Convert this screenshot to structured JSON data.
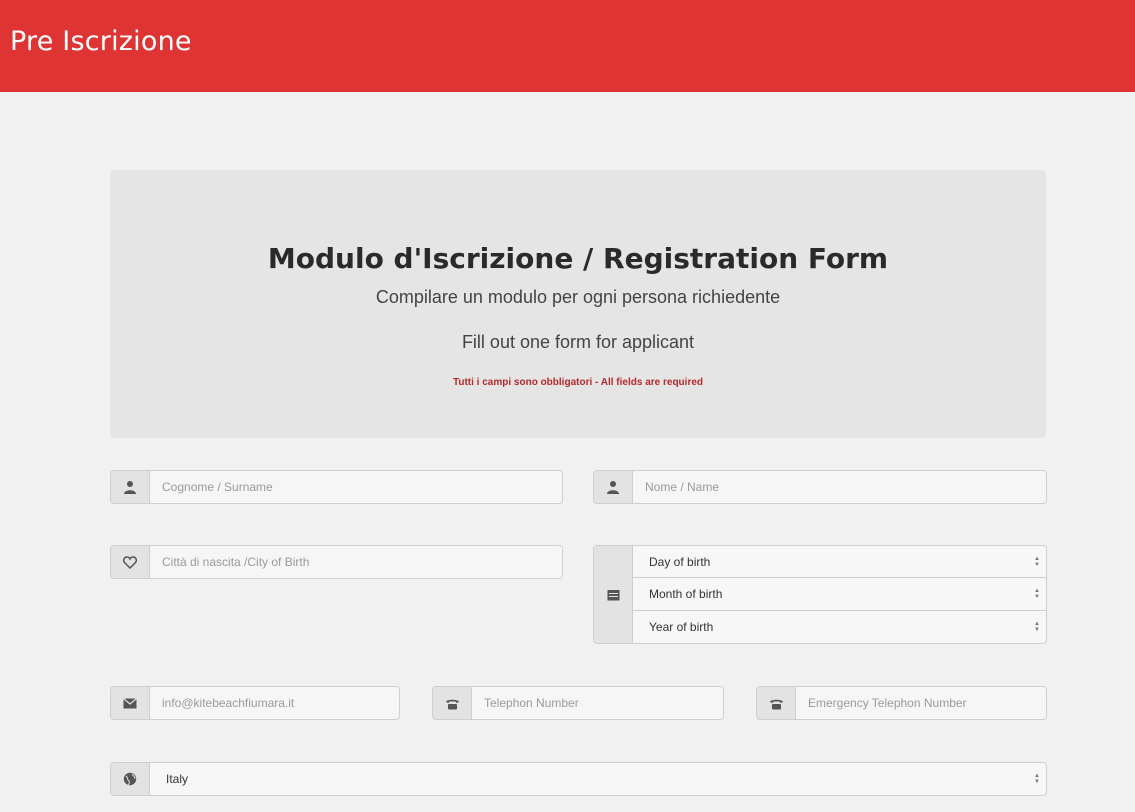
{
  "header": {
    "title": "Pre Iscrizione"
  },
  "jumbotron": {
    "title": "Modulo d'Iscrizione / Registration Form",
    "subtitle_it": "Compilare un modulo per ogni persona richiedente",
    "subtitle_en": "Fill out one form for applicant",
    "required_note": "Tutti i campi sono obbligatori - All fields are required"
  },
  "form": {
    "surname": {
      "placeholder": "Cognome / Surname",
      "icon": "user-icon"
    },
    "name": {
      "placeholder": "Nome / Name",
      "icon": "user-icon"
    },
    "birth_city": {
      "placeholder": "Città di nascita /City of Birth",
      "icon": "heart-icon"
    },
    "dob": {
      "icon": "calendar-icon",
      "day": "Day of birth",
      "month": "Month of birth",
      "year": "Year of birth"
    },
    "email": {
      "placeholder": "info@kitebeachfiumara.it",
      "icon": "envelope-icon"
    },
    "telephone": {
      "placeholder": "Telephon Number",
      "icon": "phone-icon"
    },
    "emergency_telephone": {
      "placeholder": "Emergency Telephon Number",
      "icon": "phone-icon"
    },
    "country": {
      "value": "Italy",
      "icon": "globe-icon"
    }
  }
}
